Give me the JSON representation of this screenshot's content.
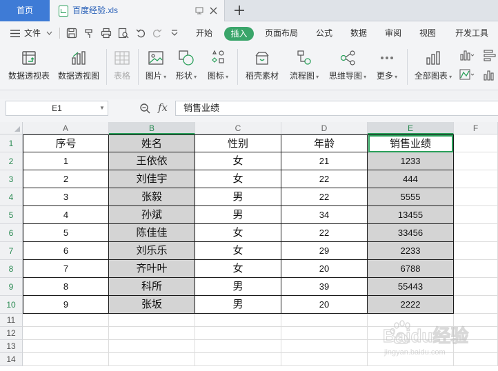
{
  "tabs": {
    "home_label": "首页",
    "file_label": "百度经验.xls"
  },
  "menu": {
    "file_label": "文件",
    "items": [
      "开始",
      "插入",
      "页面布局",
      "公式",
      "数据",
      "审阅",
      "视图",
      "开发工具"
    ],
    "active": "插入"
  },
  "ribbon": {
    "buttons": [
      {
        "label": "数据透视表",
        "icon": "pivot-table-icon"
      },
      {
        "label": "数据透视图",
        "icon": "pivot-chart-icon"
      },
      {
        "label": "表格",
        "icon": "table-icon",
        "disabled": true
      },
      {
        "label": "图片",
        "icon": "picture-icon"
      },
      {
        "label": "形状",
        "icon": "shape-icon"
      },
      {
        "label": "图标",
        "icon": "icon-library-icon"
      },
      {
        "label": "稻壳素材",
        "icon": "docer-material-icon"
      },
      {
        "label": "流程图",
        "icon": "flowchart-icon"
      },
      {
        "label": "思维导图",
        "icon": "mindmap-icon"
      },
      {
        "label": "更多",
        "icon": "more-icon"
      },
      {
        "label": "全部图表",
        "icon": "all-charts-icon"
      }
    ]
  },
  "formula_bar": {
    "name_box": "E1",
    "fx_label": "fx",
    "content": "销售业绩"
  },
  "sheet": {
    "columns": [
      "A",
      "B",
      "C",
      "D",
      "E",
      "F"
    ],
    "selected_column": "E",
    "active_cell": "E1",
    "row_numbers": [
      "1",
      "2",
      "3",
      "4",
      "5",
      "6",
      "7",
      "8",
      "9",
      "10",
      "11",
      "12",
      "13",
      "14"
    ],
    "headers": [
      "序号",
      "姓名",
      "性别",
      "年龄",
      "销售业绩"
    ],
    "rows": [
      [
        "1",
        "王依依",
        "女",
        "21",
        "1233"
      ],
      [
        "2",
        "刘佳宇",
        "女",
        "22",
        "444"
      ],
      [
        "3",
        "张毅",
        "男",
        "22",
        "5555"
      ],
      [
        "4",
        "孙斌",
        "男",
        "34",
        "13455"
      ],
      [
        "5",
        "陈佳佳",
        "女",
        "22",
        "33456"
      ],
      [
        "6",
        "刘乐乐",
        "女",
        "29",
        "2233"
      ],
      [
        "7",
        "齐叶叶",
        "女",
        "20",
        "6788"
      ],
      [
        "8",
        "科所",
        "男",
        "39",
        "55443"
      ],
      [
        "9",
        "张坂",
        "男",
        "20",
        "2222"
      ]
    ]
  },
  "watermark": {
    "text": "Baidu经验",
    "url_text": "jingyan.baidu.com"
  },
  "colors": {
    "accent_green": "#2aa05a",
    "home_tab_blue": "#3e7bd6",
    "gray_fill": "#d4d4d4"
  }
}
